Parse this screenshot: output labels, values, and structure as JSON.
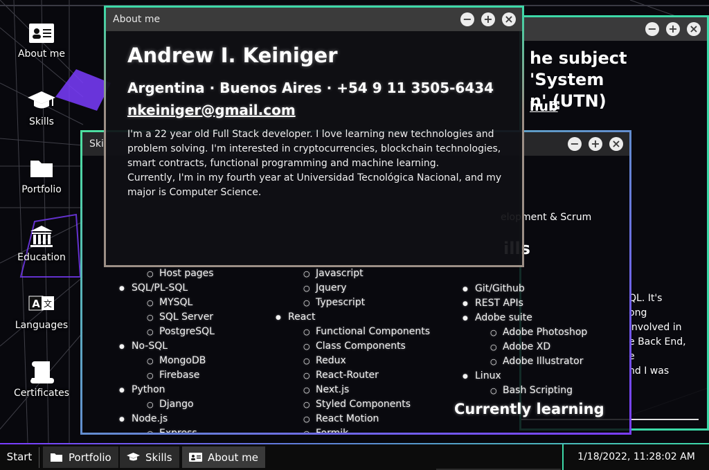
{
  "desktop": {
    "icons": [
      {
        "label": "About me",
        "icon": "id-card-icon"
      },
      {
        "label": "Skills",
        "icon": "graduation-cap-icon"
      },
      {
        "label": "Portfolio",
        "icon": "folder-icon"
      },
      {
        "label": "Education",
        "icon": "institution-icon"
      },
      {
        "label": "Languages",
        "icon": "translate-icon"
      },
      {
        "label": "Certificates",
        "icon": "scroll-icon"
      }
    ]
  },
  "windows": {
    "education": {
      "heading": "he subject 'System\nn' (UTN)",
      "link": "hub",
      "body": "QL. It's\nong\ninvolved in\ne Back End,\ne\nnd I was"
    },
    "skills": {
      "title": "Ski",
      "col1": {
        "items": [
          {
            "level": "l2",
            "text": "Host pages"
          },
          {
            "level": "l1",
            "text": "SQL/PL-SQL"
          },
          {
            "level": "l2",
            "text": "MYSQL"
          },
          {
            "level": "l2",
            "text": "SQL Server"
          },
          {
            "level": "l2",
            "text": "PostgreSQL"
          },
          {
            "level": "l1",
            "text": "No-SQL"
          },
          {
            "level": "l2",
            "text": "MongoDB"
          },
          {
            "level": "l2",
            "text": "Firebase"
          },
          {
            "level": "l1",
            "text": "Python"
          },
          {
            "level": "l2",
            "text": "Django"
          },
          {
            "level": "l1",
            "text": "Node.js"
          },
          {
            "level": "l2",
            "text": "Express"
          }
        ]
      },
      "col2": {
        "items": [
          {
            "level": "l2",
            "text": "Javascript"
          },
          {
            "level": "l2",
            "text": "Jquery"
          },
          {
            "level": "l2",
            "text": "Typescript"
          },
          {
            "level": "l1",
            "text": "React"
          },
          {
            "level": "l2",
            "text": "Functional Components"
          },
          {
            "level": "l2",
            "text": "Class Components"
          },
          {
            "level": "l2",
            "text": "Redux"
          },
          {
            "level": "l2",
            "text": "React-Router"
          },
          {
            "level": "l2",
            "text": "Next.js"
          },
          {
            "level": "l2",
            "text": "Styled Components"
          },
          {
            "level": "l2",
            "text": "React Motion"
          },
          {
            "level": "l2",
            "text": "Formik"
          }
        ]
      },
      "col3": {
        "items": [
          {
            "level": "l1",
            "text": "Git/Github"
          },
          {
            "level": "l1",
            "text": "REST APIs"
          },
          {
            "level": "l1",
            "text": "Adobe suite"
          },
          {
            "level": "l2",
            "text": "Adobe Photoshop"
          },
          {
            "level": "l2",
            "text": "Adobe XD"
          },
          {
            "level": "l2",
            "text": "Adobe Illustrator"
          },
          {
            "level": "l1",
            "text": "Linux"
          },
          {
            "level": "l2",
            "text": "Bash Scripting"
          }
        ]
      },
      "frag_mgmt": "elopment & Scrum",
      "frag_skills": "ills",
      "learning": "Currently learning"
    },
    "about": {
      "title": "About me",
      "name": "Andrew I. Keiniger",
      "location": "Argentina · Buenos Aires · +54 9 11 3505-6434",
      "email": "nkeiniger@gmail.com",
      "bio_1": "I'm a 22 year old Full Stack developer. I love learning new technologies and problem solving. I'm interested in cryptocurrencies, blockchain technologies, smart contracts, functional programming and machine learning.",
      "bio_2": "Currently, I'm in my fourth year at Universidad Tecnológica Nacional, and my major is Computer Science."
    },
    "controls": {
      "minimize": "−",
      "maximize": "+",
      "close": "×"
    }
  },
  "taskbar": {
    "start": "Start",
    "buttons": [
      {
        "label": "Portfolio",
        "icon": "folder-icon"
      },
      {
        "label": "Skills",
        "icon": "graduation-cap-icon"
      },
      {
        "label": "About me",
        "icon": "id-card-icon",
        "active": true
      }
    ],
    "clock": "1/18/2022, 11:28:02 AM"
  },
  "colors": {
    "accent_green": "#3dd9a8",
    "accent_purple": "#7a3cff"
  }
}
